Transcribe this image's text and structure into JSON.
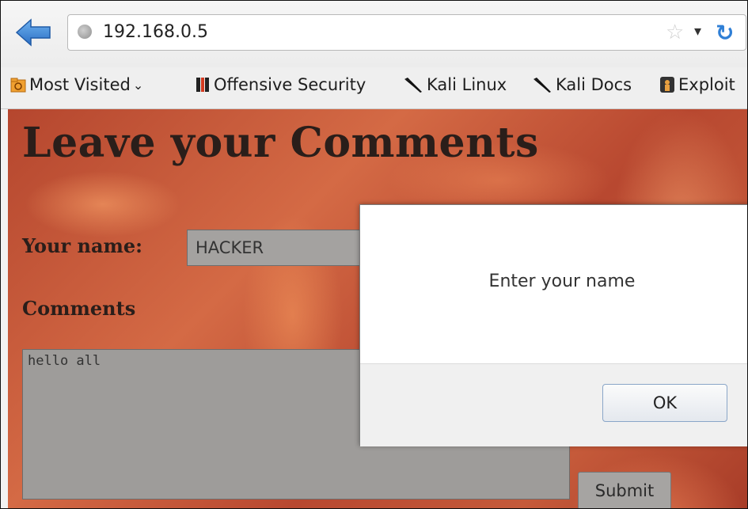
{
  "browser": {
    "url": "192.168.0.5",
    "icons": {
      "back": "back-arrow-icon",
      "site": "globe-icon",
      "bookmark_star": "star-icon",
      "dropdown": "chevron-down-icon",
      "reload": "reload-icon"
    },
    "accent_color": "#2f7fd6"
  },
  "bookmarks": [
    {
      "label": "Most Visited",
      "icon": "folder-icon"
    },
    {
      "label": "Offensive Security",
      "icon": "offsec-icon"
    },
    {
      "label": "Kali Linux",
      "icon": "kali-dragon-icon"
    },
    {
      "label": "Kali Docs",
      "icon": "kali-dragon-icon"
    },
    {
      "label": "Exploit",
      "icon": "exploit-db-icon"
    }
  ],
  "page": {
    "title": "Leave your Comments",
    "name_label": "Your name:",
    "name_value": "HACKER",
    "comments_label": "Comments",
    "comments_value": "hello all",
    "submit_label": "Submit"
  },
  "dialog": {
    "message": "Enter your name",
    "ok_label": "OK"
  }
}
